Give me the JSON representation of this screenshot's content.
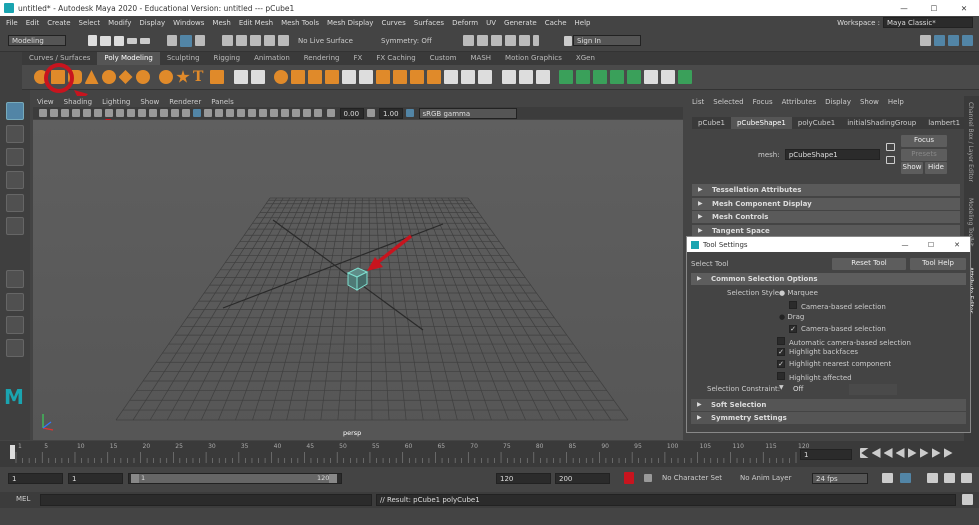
{
  "window": {
    "title": "untitled* - Autodesk Maya 2020 - Educational Version: untitled  ---  pCube1",
    "min": "—",
    "max": "☐",
    "close": "✕"
  },
  "menus": [
    "File",
    "Edit",
    "Create",
    "Select",
    "Modify",
    "Display",
    "Windows",
    "Mesh",
    "Edit Mesh",
    "Mesh Tools",
    "Mesh Display",
    "Curves",
    "Surfaces",
    "Deform",
    "UV",
    "Generate",
    "Cache",
    "Help"
  ],
  "workspace": {
    "label": "Workspace :",
    "value": "Maya Classic*"
  },
  "status": {
    "mode": "Modeling",
    "live_surface": "No Live Surface",
    "symmetry": "Symmetry: Off",
    "sign_in": "Sign In"
  },
  "shelf_tabs": [
    "Curves / Surfaces",
    "Poly Modeling",
    "Sculpting",
    "Rigging",
    "Animation",
    "Rendering",
    "FX",
    "FX Caching",
    "Custom",
    "MASH",
    "Motion Graphics",
    "XGen"
  ],
  "shelf_active": "Poly Modeling",
  "panel_menu": [
    "View",
    "Shading",
    "Lighting",
    "Show",
    "Renderer",
    "Panels"
  ],
  "panel_tools": {
    "val1": "0.00",
    "val2": "1.00",
    "colorspace": "sRGB gamma"
  },
  "viewport": {
    "camera": "persp"
  },
  "attr_menu": [
    "List",
    "Selected",
    "Focus",
    "Attributes",
    "Display",
    "Show",
    "Help"
  ],
  "attr_tabs": [
    "pCube1",
    "pCubeShape1",
    "polyCube1",
    "initialShadingGroup",
    "lambert1"
  ],
  "attr_active_tab": "pCubeShape1",
  "mesh": {
    "label": "mesh:",
    "value": "pCubeShape1",
    "focus": "Focus",
    "presets": "Presets",
    "show": "Show",
    "hide": "Hide"
  },
  "attr_sections": [
    "Tessellation Attributes",
    "Mesh Component Display",
    "Mesh Controls",
    "Tangent Space"
  ],
  "tool_settings": {
    "title": "Tool Settings",
    "tool_name": "Select Tool",
    "reset": "Reset Tool",
    "help": "Tool Help",
    "common": "Common Selection Options",
    "selection_style_label": "Selection Style:",
    "marquee": "Marquee",
    "camera_based_1": "Camera-based selection",
    "drag": "Drag",
    "camera_based_2": "Camera-based selection",
    "auto_camera": "Automatic camera-based selection",
    "highlight_backfaces": "Highlight backfaces",
    "highlight_nearest": "Highlight nearest component",
    "highlight_affected": "Highlight affected",
    "constraint_label": "Selection Constraint:",
    "constraint_value": "Off",
    "soft_selection": "Soft Selection",
    "symmetry_settings": "Symmetry Settings"
  },
  "side_tabs": [
    "Channel Box / Layer Editor",
    "Modeling Toolkit",
    "Attribute Editor"
  ],
  "timeline": {
    "ticks": [
      "1",
      "5",
      "10",
      "15",
      "20",
      "25",
      "30",
      "35",
      "40",
      "45",
      "50",
      "55",
      "60",
      "65",
      "70",
      "75",
      "80",
      "85",
      "90",
      "95",
      "100",
      "105",
      "110",
      "115",
      "120"
    ],
    "current": "1"
  },
  "range": {
    "start": "1",
    "start2": "1",
    "slider_start": "1",
    "slider_end": "120",
    "end": "120",
    "end2": "200",
    "character_set": "No Character Set",
    "anim_layer": "No Anim Layer",
    "fps": "24 fps"
  },
  "mel": {
    "label": "MEL",
    "result": "// Result: pCube1 polyCube1"
  },
  "colors": {
    "accent": "#5285a6",
    "annotation": "#c8141e",
    "selected_cube": "#7fe0d0"
  }
}
